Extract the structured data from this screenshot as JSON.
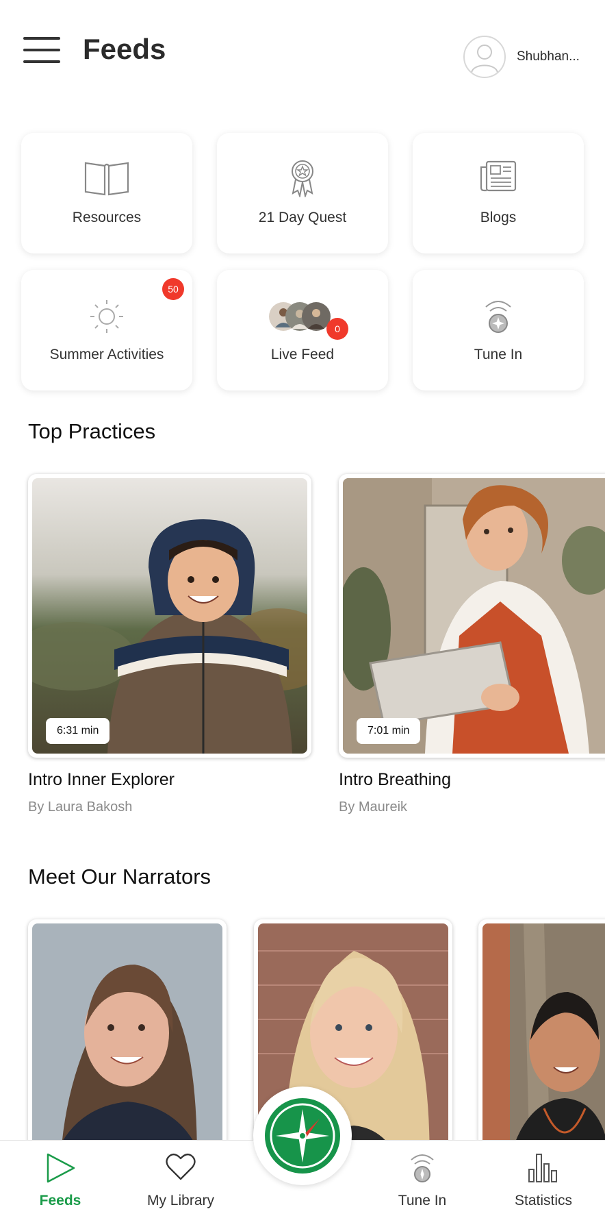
{
  "header": {
    "title": "Feeds",
    "user_name": "Shubhan..."
  },
  "tiles": [
    {
      "label": "Resources",
      "icon": "book-icon"
    },
    {
      "label": "21 Day Quest",
      "icon": "award-ribbon-icon"
    },
    {
      "label": "Blogs",
      "icon": "newspaper-icon"
    },
    {
      "label": "Summer Activities",
      "icon": "sun-icon",
      "badge": "50"
    },
    {
      "label": "Live Feed",
      "icon": "live-feed-thumbnails",
      "badge": "0"
    },
    {
      "label": "Tune In",
      "icon": "tune-in-icon"
    }
  ],
  "sections": {
    "top_practices": "Top Practices",
    "meet_narrators": "Meet Our Narrators"
  },
  "practices": [
    {
      "title": "Intro Inner Explorer",
      "author": "By Laura Bakosh",
      "duration": "6:31 min"
    },
    {
      "title": "Intro Breathing",
      "author": "By Maureik",
      "duration": "7:01 min"
    }
  ],
  "bottom_nav": [
    {
      "label": "Feeds",
      "icon": "play-triangle-icon",
      "active": true
    },
    {
      "label": "My Library",
      "icon": "heart-icon",
      "active": false
    },
    {
      "label": "Tune In",
      "icon": "tune-in-icon",
      "active": false
    },
    {
      "label": "Statistics",
      "icon": "bar-chart-icon",
      "active": false
    }
  ],
  "center_button": {
    "icon": "compass-icon"
  },
  "colors": {
    "accent_green": "#1a9b49",
    "badge_red": "#f0392b",
    "text_dark": "#2b2b2b",
    "text_muted": "#8a8a8a"
  }
}
